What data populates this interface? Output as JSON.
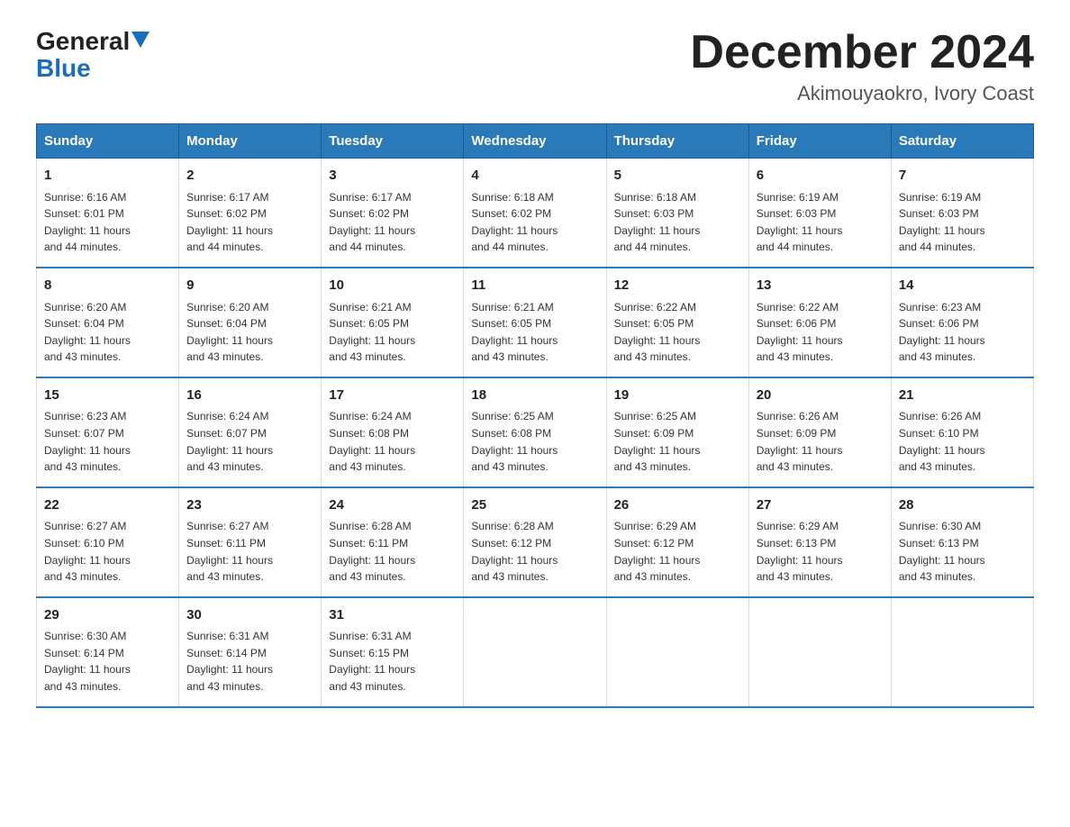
{
  "logo": {
    "general": "General",
    "blue": "Blue",
    "arrow": "▶"
  },
  "title": "December 2024",
  "subtitle": "Akimouyaokro, Ivory Coast",
  "days_of_week": [
    "Sunday",
    "Monday",
    "Tuesday",
    "Wednesday",
    "Thursday",
    "Friday",
    "Saturday"
  ],
  "weeks": [
    [
      {
        "day": "1",
        "sunrise": "6:16 AM",
        "sunset": "6:01 PM",
        "daylight": "11 hours and 44 minutes."
      },
      {
        "day": "2",
        "sunrise": "6:17 AM",
        "sunset": "6:02 PM",
        "daylight": "11 hours and 44 minutes."
      },
      {
        "day": "3",
        "sunrise": "6:17 AM",
        "sunset": "6:02 PM",
        "daylight": "11 hours and 44 minutes."
      },
      {
        "day": "4",
        "sunrise": "6:18 AM",
        "sunset": "6:02 PM",
        "daylight": "11 hours and 44 minutes."
      },
      {
        "day": "5",
        "sunrise": "6:18 AM",
        "sunset": "6:03 PM",
        "daylight": "11 hours and 44 minutes."
      },
      {
        "day": "6",
        "sunrise": "6:19 AM",
        "sunset": "6:03 PM",
        "daylight": "11 hours and 44 minutes."
      },
      {
        "day": "7",
        "sunrise": "6:19 AM",
        "sunset": "6:03 PM",
        "daylight": "11 hours and 44 minutes."
      }
    ],
    [
      {
        "day": "8",
        "sunrise": "6:20 AM",
        "sunset": "6:04 PM",
        "daylight": "11 hours and 43 minutes."
      },
      {
        "day": "9",
        "sunrise": "6:20 AM",
        "sunset": "6:04 PM",
        "daylight": "11 hours and 43 minutes."
      },
      {
        "day": "10",
        "sunrise": "6:21 AM",
        "sunset": "6:05 PM",
        "daylight": "11 hours and 43 minutes."
      },
      {
        "day": "11",
        "sunrise": "6:21 AM",
        "sunset": "6:05 PM",
        "daylight": "11 hours and 43 minutes."
      },
      {
        "day": "12",
        "sunrise": "6:22 AM",
        "sunset": "6:05 PM",
        "daylight": "11 hours and 43 minutes."
      },
      {
        "day": "13",
        "sunrise": "6:22 AM",
        "sunset": "6:06 PM",
        "daylight": "11 hours and 43 minutes."
      },
      {
        "day": "14",
        "sunrise": "6:23 AM",
        "sunset": "6:06 PM",
        "daylight": "11 hours and 43 minutes."
      }
    ],
    [
      {
        "day": "15",
        "sunrise": "6:23 AM",
        "sunset": "6:07 PM",
        "daylight": "11 hours and 43 minutes."
      },
      {
        "day": "16",
        "sunrise": "6:24 AM",
        "sunset": "6:07 PM",
        "daylight": "11 hours and 43 minutes."
      },
      {
        "day": "17",
        "sunrise": "6:24 AM",
        "sunset": "6:08 PM",
        "daylight": "11 hours and 43 minutes."
      },
      {
        "day": "18",
        "sunrise": "6:25 AM",
        "sunset": "6:08 PM",
        "daylight": "11 hours and 43 minutes."
      },
      {
        "day": "19",
        "sunrise": "6:25 AM",
        "sunset": "6:09 PM",
        "daylight": "11 hours and 43 minutes."
      },
      {
        "day": "20",
        "sunrise": "6:26 AM",
        "sunset": "6:09 PM",
        "daylight": "11 hours and 43 minutes."
      },
      {
        "day": "21",
        "sunrise": "6:26 AM",
        "sunset": "6:10 PM",
        "daylight": "11 hours and 43 minutes."
      }
    ],
    [
      {
        "day": "22",
        "sunrise": "6:27 AM",
        "sunset": "6:10 PM",
        "daylight": "11 hours and 43 minutes."
      },
      {
        "day": "23",
        "sunrise": "6:27 AM",
        "sunset": "6:11 PM",
        "daylight": "11 hours and 43 minutes."
      },
      {
        "day": "24",
        "sunrise": "6:28 AM",
        "sunset": "6:11 PM",
        "daylight": "11 hours and 43 minutes."
      },
      {
        "day": "25",
        "sunrise": "6:28 AM",
        "sunset": "6:12 PM",
        "daylight": "11 hours and 43 minutes."
      },
      {
        "day": "26",
        "sunrise": "6:29 AM",
        "sunset": "6:12 PM",
        "daylight": "11 hours and 43 minutes."
      },
      {
        "day": "27",
        "sunrise": "6:29 AM",
        "sunset": "6:13 PM",
        "daylight": "11 hours and 43 minutes."
      },
      {
        "day": "28",
        "sunrise": "6:30 AM",
        "sunset": "6:13 PM",
        "daylight": "11 hours and 43 minutes."
      }
    ],
    [
      {
        "day": "29",
        "sunrise": "6:30 AM",
        "sunset": "6:14 PM",
        "daylight": "11 hours and 43 minutes."
      },
      {
        "day": "30",
        "sunrise": "6:31 AM",
        "sunset": "6:14 PM",
        "daylight": "11 hours and 43 minutes."
      },
      {
        "day": "31",
        "sunrise": "6:31 AM",
        "sunset": "6:15 PM",
        "daylight": "11 hours and 43 minutes."
      },
      null,
      null,
      null,
      null
    ]
  ]
}
